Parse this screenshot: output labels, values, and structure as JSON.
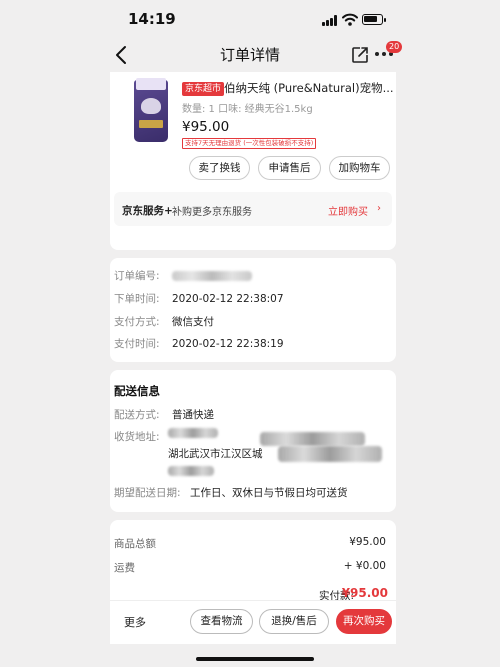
{
  "status_bar": {
    "time": "14:19"
  },
  "nav": {
    "title": "订单详情",
    "badge_count": "20"
  },
  "product": {
    "store_tag": "京东超市",
    "name": "伯纳天纯 (Pure&Natural)宠物...",
    "spec": "数量: 1  口味: 经典无谷1.5kg",
    "price": "¥95.00",
    "return_note": "支持7天无理由退货 (一次性包装破损不支持)",
    "buttons": {
      "sell": "卖了换钱",
      "aftersale": "申请售后",
      "add_cart": "加购物车"
    },
    "service": {
      "title": "京东服务+",
      "desc": "补购更多京东服务",
      "link": "立即购买",
      "arrow": "›"
    }
  },
  "order_info": {
    "number_label": "订单编号:",
    "placed_label": "下单时间:",
    "placed_value": "2020-02-12 22:38:07",
    "pay_method_label": "支付方式:",
    "pay_method_value": "微信支付",
    "pay_time_label": "支付时间:",
    "pay_time_value": "2020-02-12 22:38:19"
  },
  "delivery": {
    "title": "配送信息",
    "method_label": "配送方式:",
    "method_value": "普通快递",
    "address_label": "收货地址:",
    "address_visible": "湖北武汉市江汉区城",
    "expected_label": "期望配送日期:",
    "expected_value": "工作日、双休日与节假日均可送货"
  },
  "summary": {
    "goods_total_label": "商品总额",
    "goods_total_value": "¥95.00",
    "shipping_label": "运费",
    "shipping_value": "+ ¥0.00",
    "paid_label": "实付款:",
    "paid_value": "¥95.00"
  },
  "bottom_bar": {
    "more": "更多",
    "logistics": "查看物流",
    "exchange": "退换/售后",
    "rebuy": "再次购买"
  },
  "colors": {
    "accent": "#e4393c",
    "background": "#f0efef",
    "card": "#ffffff"
  }
}
